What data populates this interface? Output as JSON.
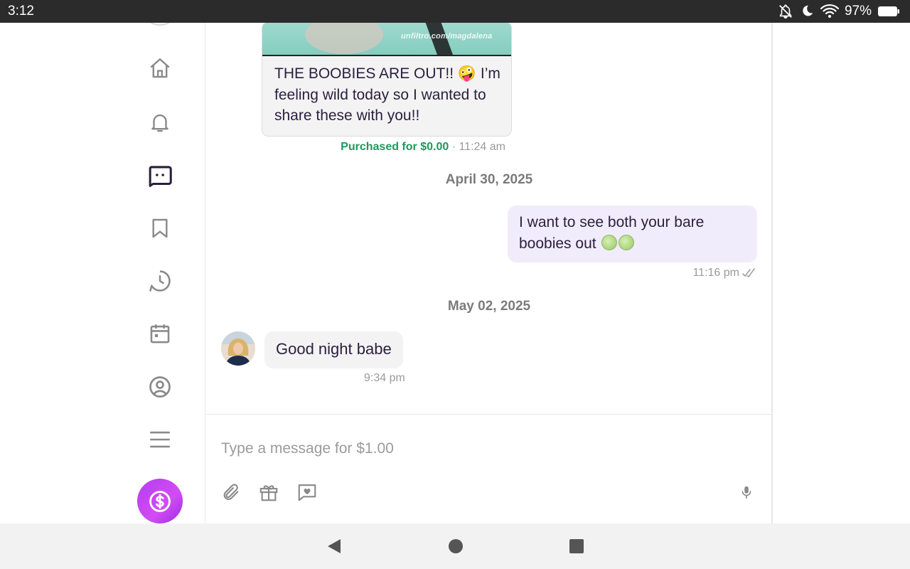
{
  "status_bar": {
    "time": "3:12",
    "battery_percent": "97%",
    "icons": [
      "notifications-off-icon",
      "do-not-disturb-moon-icon",
      "wifi-icon",
      "battery-icon"
    ]
  },
  "sidebar": {
    "items": [
      {
        "name": "home",
        "icon": "home-icon"
      },
      {
        "name": "notifications",
        "icon": "bell-icon"
      },
      {
        "name": "messages",
        "icon": "chat-icon",
        "active": true
      },
      {
        "name": "bookmarks",
        "icon": "bookmark-icon"
      },
      {
        "name": "history",
        "icon": "clock-icon"
      },
      {
        "name": "calendar",
        "icon": "calendar-icon"
      },
      {
        "name": "profile",
        "icon": "user-icon"
      },
      {
        "name": "menu",
        "icon": "hamburger-menu-icon"
      }
    ],
    "tip_button_icon": "dollar-circle-icon"
  },
  "conversation": {
    "media_message": {
      "watermark": "unfiltro.com/magdalena",
      "text": "THE BOOBIES ARE OUT!! 🤪 I’m feeling wild today so I wanted to share these with you!!",
      "purchased_label": "Purchased for $0.00",
      "separator": " · ",
      "time": "11:24 am"
    },
    "date_1": "April 30, 2025",
    "outgoing_message": {
      "text": "I want to see both your bare boobies out",
      "emoji": [
        "melon",
        "melon"
      ],
      "time": "11:16 pm",
      "status": "read"
    },
    "date_2": "May 02, 2025",
    "incoming_message": {
      "text": "Good night babe",
      "time": "9:34 pm"
    }
  },
  "composer": {
    "placeholder": "Type a message for $1.00",
    "tools": [
      "paperclip-icon",
      "gift-icon",
      "message-heart-icon"
    ],
    "mic_icon": "microphone-icon"
  },
  "system_nav": [
    "back-icon",
    "home-circle-icon",
    "recents-square-icon"
  ],
  "colors": {
    "accent_purple": "#b33df0",
    "outgoing_bubble": "#f1ecfb",
    "incoming_bubble": "#f3f3f4",
    "purchased_green": "#1a9b5c",
    "active_icon": "#2a1f3d",
    "inactive_icon": "#8a8a8a"
  }
}
